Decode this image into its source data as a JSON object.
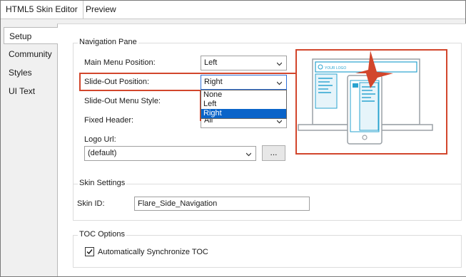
{
  "window": {
    "tabs": [
      {
        "label": "HTML5 Skin Editor"
      },
      {
        "label": "Preview"
      }
    ]
  },
  "sidebar": {
    "items": [
      {
        "label": "Setup",
        "active": true
      },
      {
        "label": "Community"
      },
      {
        "label": "Styles"
      },
      {
        "label": "UI Text"
      }
    ]
  },
  "navigation_pane": {
    "title": "Navigation Pane",
    "main_menu_position": {
      "label": "Main Menu Position:",
      "value": "Left"
    },
    "slide_out_position": {
      "label": "Slide-Out Position:",
      "value": "Right",
      "options": [
        "None",
        "Left",
        "Right"
      ],
      "selected": "Right"
    },
    "slide_out_menu_style": {
      "label": "Slide-Out Menu Style:"
    },
    "fixed_header": {
      "label": "Fixed Header:",
      "value": "All"
    },
    "logo_url": {
      "label": "Logo Url:",
      "value": "(default)",
      "browse_label": "..."
    }
  },
  "preview_graphic": {
    "logo_text": "YOUR LOGO"
  },
  "skin_settings": {
    "title": "Skin Settings",
    "skin_id": {
      "label": "Skin ID:",
      "value": "Flare_Side_Navigation"
    }
  },
  "toc_options": {
    "title": "TOC Options",
    "auto_sync": {
      "label": "Automatically Synchronize TOC",
      "checked": true
    }
  },
  "colors": {
    "callout": "#d2462c",
    "selection": "#0a64c9",
    "illustration": "#2aa3cf"
  }
}
